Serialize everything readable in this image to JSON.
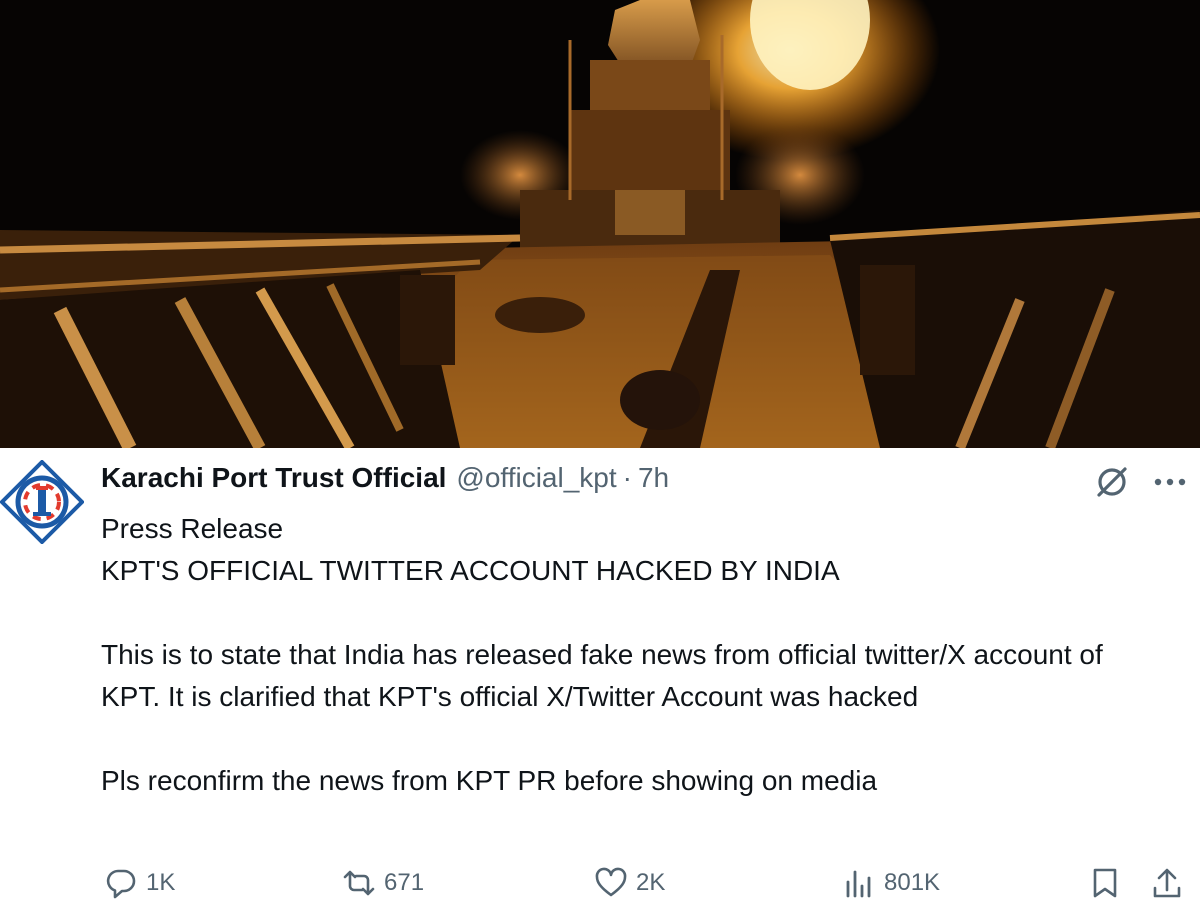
{
  "media": {
    "image_icon": "warship-night-photo"
  },
  "tweet": {
    "author_name": "Karachi Port Trust Official",
    "handle": "@official_kpt",
    "separator": "·",
    "time": "7h",
    "body_lines": [
      "Press Release",
      "KPT'S OFFICIAL TWITTER ACCOUNT HACKED BY INDIA",
      "This is to state that India has released fake news from official twitter/X account of KPT. It is clarified that KPT's official X/Twitter Account was hacked",
      "Pls reconfirm the news from KPT PR before showing on media"
    ]
  },
  "actions": {
    "replies": "1K",
    "reposts": "671",
    "likes": "2K",
    "views": "801K"
  },
  "colors": {
    "text": "#0f1419",
    "muted": "#536471",
    "logo_blue": "#1c5aa6"
  }
}
